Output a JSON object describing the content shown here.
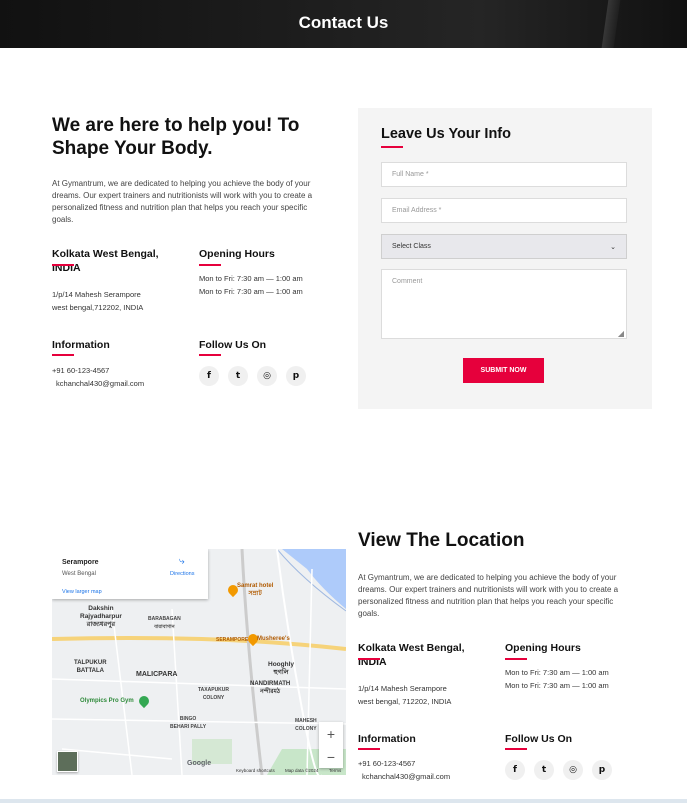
{
  "hero": {
    "title": "Contact Us"
  },
  "intro": {
    "heading_line1": "We are here to help you! To",
    "heading_line2": "Shape Your Body.",
    "paragraph": "At Gymantrum, we are dedicated to helping you achieve the body of your dreams. Our expert trainers and nutritionists will work with you to create a personalized fitness and nutrition plan that helps you reach your specific goals.",
    "address_title_line1": "Kolkata West Bengal,",
    "address_title_line2": "INDIA",
    "address_line1": "1/p/14 Mahesh Serampore",
    "address_line2": "west bengal,712202, INDIA",
    "hours_title": "Opening Hours",
    "hours_line1": "Mon to Fri: 7:30 am — 1:00 am",
    "hours_line2": "Mon to Fri: 7:30 am — 1:00 am",
    "info_title": "Information",
    "phone": "+91 60-123-4567",
    "email": "kchanchal430@gmail.com",
    "follow_title": "Follow Us On"
  },
  "social": [
    {
      "icon": "facebook-icon",
      "glyph": "f"
    },
    {
      "icon": "twitter-icon",
      "glyph": "🐦"
    },
    {
      "icon": "instagram-icon",
      "glyph": "◎"
    },
    {
      "icon": "pinterest-icon",
      "glyph": "℗"
    }
  ],
  "form": {
    "title": "Leave Us Your Info",
    "full_name_placeholder": "Full Name *",
    "email_placeholder": "Email Address *",
    "class_selected": "Select Class",
    "comment_placeholder": "Comment",
    "submit_label": "SUBMIT NOW"
  },
  "location": {
    "heading": "View The Location",
    "paragraph": "At Gymantrum, we are dedicated to helping you achieve the body of your dreams. Our expert trainers and nutritionists will work with you to create a personalized fitness and nutrition plan that helps you reach your specific goals.",
    "address_title_line1": "Kolkata West Bengal,",
    "address_title_line2": "INDIA",
    "address_line1": "1/p/14 Mahesh Serampore",
    "address_line2": "west bengal, 712202, INDIA",
    "hours_title": "Opening Hours",
    "hours_line1": "Mon to Fri: 7:30 am — 1:00 am",
    "hours_line2": "Mon to Fri: 7:30 am — 1:00 am",
    "info_title": "Information",
    "phone": "+91 60-123-4567",
    "email": "kchanchal430@gmail.com",
    "follow_title": "Follow Us On"
  },
  "map": {
    "place_name": "Serampore",
    "place_region": "West Bengal",
    "directions_label": "Directions",
    "view_larger": "View larger map",
    "labels": {
      "dakshin": "Dakshin\nRajyadharpur\nরাজ্যধরপুর",
      "baragagan": "BARABAGAN\nবারাবাগান",
      "serampore_road": "SERAMPORE",
      "samrat": "Samrat hotel\nসম্রাট",
      "musheree": "Musheree's",
      "talpukur": "TALPUKUR\nBATTALA",
      "malicpara": "MALICPARA",
      "hooghly": "Hooghly\nহুগলি",
      "nandirmath": "NANDIRMATH\nনন্দীরমঠ",
      "olympics": "Olympics Pro Gym",
      "taxapukur": "TAXAPUKUR\nCOLONY",
      "bingo": "BINGO\nBEHARI PALLY",
      "mahesh": "MAHESH\nCOLONY"
    },
    "zoom_in": "+",
    "zoom_out": "−",
    "google": "Google",
    "footer_shortcuts": "Keyboard shortcuts",
    "footer_data": "Map data ©2024",
    "footer_terms": "Terms"
  }
}
